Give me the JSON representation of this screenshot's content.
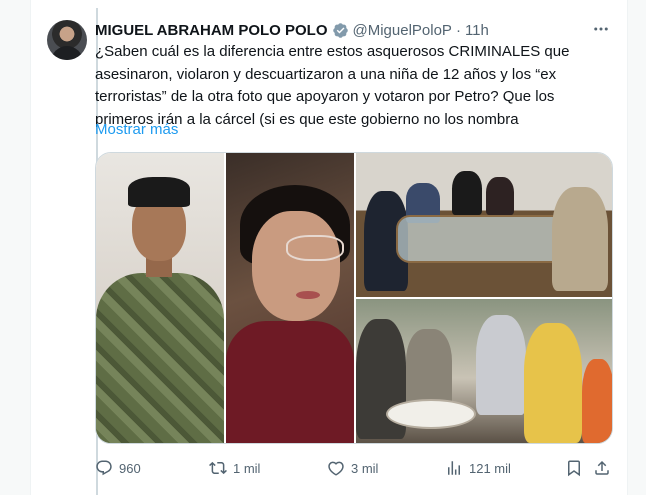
{
  "tweet": {
    "author_name": "MIGUEL ABRAHAM POLO POLO",
    "handle": "@MiguelPoloP",
    "separator": "·",
    "time": "11h",
    "text_lines": [
      "¿Saben cuál es la diferencia entre estos asquerosos CRIMINALES que",
      "asesinaron, violaron y descuartizaron a una niña de 12 años y los “ex",
      "terroristas” de la otra foto que apoyaron y votaron por Petro? Que los",
      "primeros irán a la cárcel (si es que este gobierno no los nombra"
    ],
    "show_more": "Mostrar más"
  },
  "actions": {
    "replies": "960",
    "reposts": "1 mil",
    "likes": "3 mil",
    "views": "121 mil"
  },
  "colors": {
    "accent": "#1d9bf0",
    "muted": "#536471",
    "verified": "#829aab"
  },
  "icons": [
    "more-icon",
    "verified-badge-icon",
    "reply-icon",
    "repost-icon",
    "like-icon",
    "views-icon",
    "bookmark-icon",
    "share-icon"
  ]
}
